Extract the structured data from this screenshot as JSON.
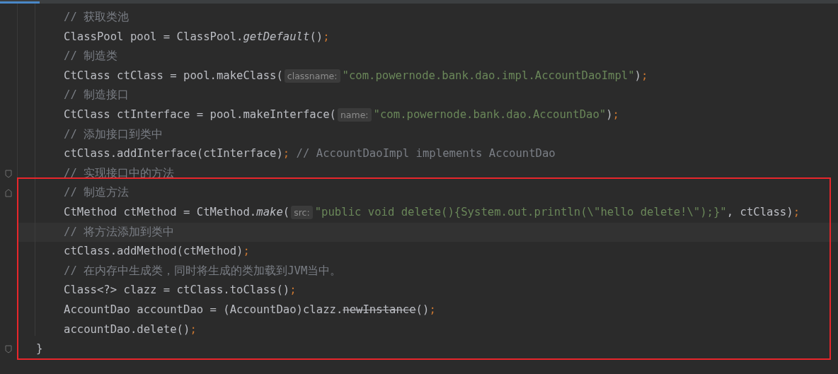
{
  "editor": {
    "lines": [
      {
        "children": [
          {
            "tokens": [
              {
                "kind": "comment",
                "text": "// 获取类池"
              }
            ]
          },
          {
            "tokens": [
              {
                "kind": "code",
                "text": "ClassPool pool = ClassPool."
              },
              {
                "kind": "italic",
                "text": "getDefault"
              },
              {
                "kind": "code",
                "text": "()"
              },
              {
                "kind": "semi",
                "text": ";"
              }
            ]
          },
          {
            "tokens": [
              {
                "kind": "comment",
                "text": "// 制造类"
              }
            ]
          },
          {
            "tokens": [
              {
                "kind": "code",
                "text": "CtClass ctClass = pool.makeClass("
              },
              {
                "kind": "hint",
                "text": "classname:"
              },
              {
                "kind": "string",
                "text": "\"com.powernode.bank.dao.impl.AccountDaoImpl\""
              },
              {
                "kind": "code",
                "text": ")"
              },
              {
                "kind": "semi",
                "text": ";"
              }
            ]
          },
          {
            "tokens": [
              {
                "kind": "comment",
                "text": "// 制造接口"
              }
            ]
          },
          {
            "tokens": [
              {
                "kind": "code",
                "text": "CtClass ctInterface = pool.makeInterface("
              },
              {
                "kind": "hint",
                "text": "name:"
              },
              {
                "kind": "string",
                "text": "\"com.powernode.bank.dao.AccountDao\""
              },
              {
                "kind": "code",
                "text": ")"
              },
              {
                "kind": "semi",
                "text": ";"
              }
            ]
          },
          {
            "tokens": [
              {
                "kind": "comment",
                "text": "// 添加接口到类中"
              }
            ]
          },
          {
            "tokens": [
              {
                "kind": "code",
                "text": "ctClass.addInterface(ctInterface)"
              },
              {
                "kind": "semi",
                "text": ";"
              },
              {
                "kind": "comment",
                "text": " // AccountDaoImpl implements AccountDao"
              }
            ]
          },
          {
            "fold_end": true,
            "tokens": [
              {
                "kind": "comment",
                "text": "// 实现接口中的方法"
              }
            ]
          },
          {
            "fold_start": true,
            "tokens": [
              {
                "kind": "comment",
                "text": "// 制造方法"
              }
            ]
          },
          {
            "tokens": [
              {
                "kind": "code",
                "text": "CtMethod ctMethod = CtMethod."
              },
              {
                "kind": "italic",
                "text": "make"
              },
              {
                "kind": "code",
                "text": "("
              },
              {
                "kind": "hint",
                "text": "src:"
              },
              {
                "kind": "string",
                "text": "\"public void delete(){System.out.println(\\\"hello delete!\\\");}\""
              },
              {
                "kind": "code",
                "text": ", ctClass)"
              },
              {
                "kind": "semi",
                "text": ";"
              }
            ]
          },
          {
            "current": true,
            "tokens": [
              {
                "kind": "comment",
                "text": "// 将方法添加到类中"
              }
            ]
          },
          {
            "tokens": [
              {
                "kind": "code",
                "text": "ctClass.addMethod(ctMethod)"
              },
              {
                "kind": "semi",
                "text": ";"
              }
            ]
          },
          {
            "tokens": [
              {
                "kind": "comment",
                "text": "// 在内存中生成类，同时将生成的类加载到JVM当中。"
              }
            ]
          },
          {
            "tokens": [
              {
                "kind": "code",
                "text": "Class<?> clazz = ctClass.toClass()"
              },
              {
                "kind": "semi",
                "text": ";"
              }
            ]
          },
          {
            "tokens": [
              {
                "kind": "code",
                "text": "AccountDao accountDao = (AccountDao)clazz."
              },
              {
                "kind": "deprecated",
                "text": "newInstance"
              },
              {
                "kind": "code",
                "text": "()"
              },
              {
                "kind": "semi",
                "text": ";"
              }
            ]
          },
          {
            "tokens": [
              {
                "kind": "code",
                "text": "accountDao.delete()"
              },
              {
                "kind": "semi",
                "text": ";"
              }
            ]
          }
        ]
      },
      {
        "fold_end": true,
        "tokens": [
          {
            "kind": "code",
            "text": "}"
          }
        ]
      }
    ]
  }
}
